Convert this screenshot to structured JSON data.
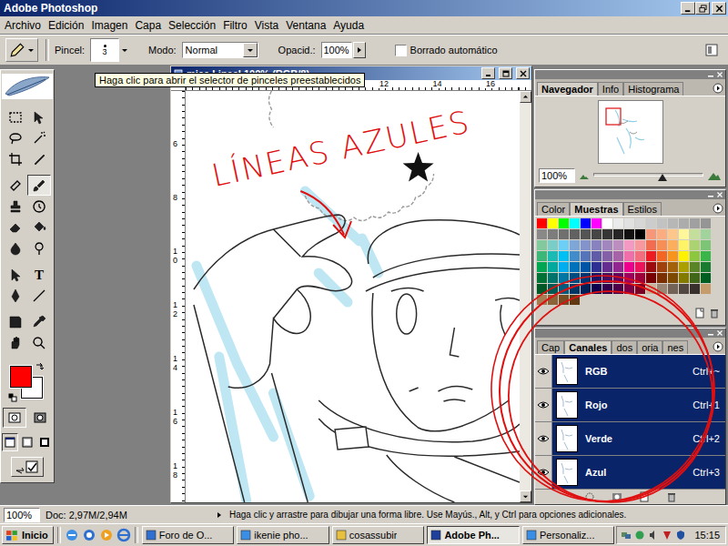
{
  "window": {
    "title": "Adobe Photoshop"
  },
  "menu": [
    "Archivo",
    "Edición",
    "Imagen",
    "Capa",
    "Selección",
    "Filtro",
    "Vista",
    "Ventana",
    "Ayuda"
  ],
  "options_bar": {
    "brush_label": "Pincel:",
    "brush_size": "3",
    "mode_label": "Modo:",
    "mode": "Normal",
    "opacity_label": "Opacid.:",
    "opacity": "100%",
    "auto_erase": {
      "label": "Borrado automático",
      "checked": false
    }
  },
  "tooltip": "Haga clic para abrir el selector de pinceles preestablecidos",
  "toolbox": {
    "tools": [
      {
        "selected": false
      },
      {
        "selected": false
      },
      {
        "selected": false
      },
      {
        "selected": false
      },
      {
        "selected": false
      },
      {
        "selected": false
      },
      {
        "selected": false
      },
      {
        "selected": true
      },
      {
        "selected": false
      },
      {
        "selected": false
      },
      {
        "selected": false
      },
      {
        "selected": false
      },
      {
        "selected": false
      },
      {
        "selected": false
      },
      {
        "selected": false
      },
      {
        "selected": false,
        "glyph": "T"
      },
      {
        "selected": false
      },
      {
        "selected": false
      },
      {
        "selected": false
      },
      {
        "selected": false
      },
      {
        "selected": false
      },
      {
        "selected": false
      }
    ],
    "foreground": "#ff0000",
    "background": "#ffffff"
  },
  "document": {
    "title": "mica Lineal 100% (RGB/8)",
    "ruler_top": [
      "12",
      "14",
      "16"
    ],
    "ruler_left": [
      "6",
      "8",
      "10",
      "12",
      "14",
      "16",
      "18"
    ],
    "annotation": "LÍNEAS AZULES"
  },
  "navigator": {
    "tabs": [
      {
        "label": "Navegador",
        "selected": true
      },
      {
        "label": "Info",
        "selected": false
      },
      {
        "label": "Histograma",
        "selected": false
      }
    ],
    "zoom": "100%",
    "level": 0.63
  },
  "swatches_panel": {
    "tabs": [
      {
        "label": "Color",
        "selected": false
      },
      {
        "label": "Muestras",
        "selected": true
      },
      {
        "label": "Estilos",
        "selected": false
      }
    ],
    "swatches": [
      "#ff0000",
      "#ffff00",
      "#00ff00",
      "#00ffff",
      "#0000ff",
      "#ff00ff",
      "#ffffff",
      "#ebebeb",
      "#e1e1e1",
      "#d7d7d7",
      "#cccccc",
      "#c2c2c2",
      "#b7b7b7",
      "#acacac",
      "#a0a0a0",
      "#959595",
      "#898989",
      "#7d7d7d",
      "#707070",
      "#626262",
      "#555555",
      "#464646",
      "#363636",
      "#262626",
      "#111111",
      "#000000",
      "#f7977a",
      "#f9ad81",
      "#fdc68a",
      "#fff79a",
      "#c4df9b",
      "#a2d39c",
      "#82ca9d",
      "#7bcdc8",
      "#6ecff6",
      "#7ea7d8",
      "#8493ca",
      "#8882be",
      "#a187be",
      "#bc8dbf",
      "#f49ac2",
      "#f6989d",
      "#f26c4f",
      "#f68e55",
      "#fbaf5c",
      "#fff467",
      "#acd372",
      "#7cc576",
      "#3bb878",
      "#1abbb4",
      "#00bff3",
      "#438ccb",
      "#5574b9",
      "#605ca8",
      "#855fa8",
      "#a763a8",
      "#f06ea9",
      "#f26d7d",
      "#ed1c24",
      "#f26522",
      "#f7941d",
      "#fff200",
      "#8dc73f",
      "#39b54a",
      "#00a651",
      "#00a99d",
      "#00aeef",
      "#0072bc",
      "#0054a6",
      "#2e3192",
      "#662d91",
      "#92278f",
      "#ec008c",
      "#ed145b",
      "#9e0b0f",
      "#a0410d",
      "#a36209",
      "#aba000",
      "#598527",
      "#1a7b30",
      "#007236",
      "#00746b",
      "#0076a3",
      "#004b80",
      "#003471",
      "#1b1464",
      "#440e62",
      "#630460",
      "#9e005d",
      "#9e0039",
      "#790000",
      "#7b2e00",
      "#7d4900",
      "#827b00",
      "#406618",
      "#005e20",
      "#005826",
      "#005952",
      "#005b7f",
      "#003663",
      "#002157",
      "#0d004c",
      "#32004b",
      "#4b0049",
      "#7b0046",
      "#7a0026",
      "#c7b299",
      "#998675",
      "#736357",
      "#534741",
      "#37302d",
      "#c69c6d",
      "#a67c52",
      "#8c6239",
      "#754c24",
      "#603913"
    ]
  },
  "channels_panel": {
    "tabs": [
      {
        "label": "Cap",
        "selected": false
      },
      {
        "label": "Canales",
        "selected": true
      },
      {
        "label": "dos",
        "selected": false
      },
      {
        "label": "oria",
        "selected": false
      },
      {
        "label": "nes",
        "selected": false
      }
    ],
    "channels": [
      {
        "name": "RGB",
        "shortcut": "Ctrl+~",
        "visible": true,
        "selected": true
      },
      {
        "name": "Rojo",
        "shortcut": "Ctrl+1",
        "visible": true,
        "selected": true
      },
      {
        "name": "Verde",
        "shortcut": "Ctrl+2",
        "visible": true,
        "selected": true
      },
      {
        "name": "Azul",
        "shortcut": "Ctrl+3",
        "visible": true,
        "selected": true
      }
    ]
  },
  "status_bar": {
    "zoom": "100%",
    "doc": "Doc: 2,97M/2,94M",
    "hint": "Haga clic y arrastre para dibujar una forma libre. Use Mayús., Alt, y Ctrl para opciones adicionales."
  },
  "taskbar": {
    "start": "Inicio",
    "tasks": [
      {
        "label": "Foro de O...",
        "selected": false
      },
      {
        "label": "ikenie pho...",
        "selected": false
      },
      {
        "label": "cosassubir",
        "selected": false
      },
      {
        "label": "Adobe Ph...",
        "selected": true
      },
      {
        "label": "Personaliz...",
        "selected": false
      }
    ],
    "clock": "15:15"
  }
}
